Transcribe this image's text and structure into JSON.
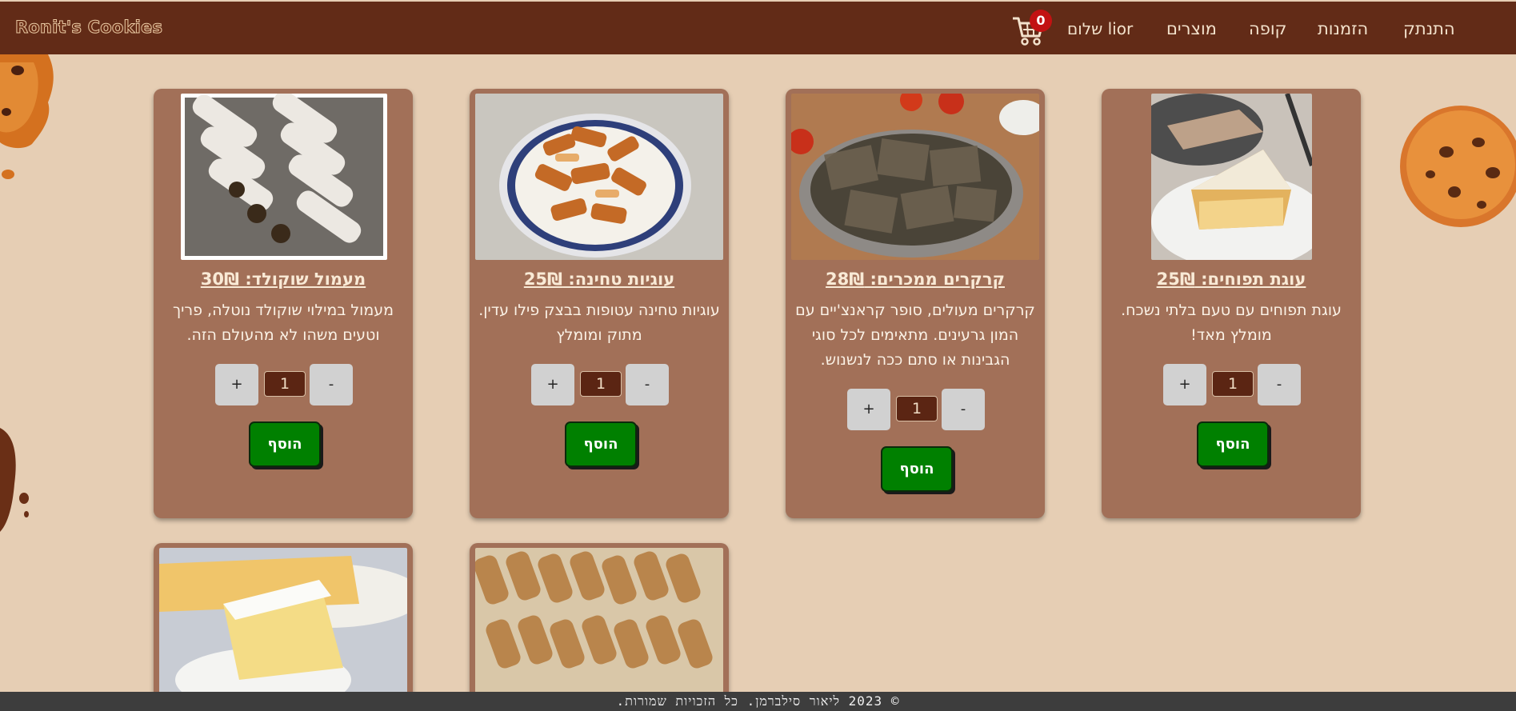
{
  "header": {
    "logo": "Ronit's Cookies",
    "nav": {
      "logout": "התנתק",
      "orders": "הזמנות",
      "checkout": "קופה",
      "products": "מוצרים"
    },
    "greeting": "שלום lior",
    "cart": {
      "count": "0",
      "icon": "cart-icon"
    }
  },
  "products": [
    {
      "title": "עוגת תפוחים: 25₪",
      "description": "עוגת תפוחים עם טעם בלתי נשכח. מומלץ מאד!",
      "quantity": "1",
      "plus": "+",
      "minus": "-",
      "add_label": "הוסף",
      "image": "apple-cake-photo"
    },
    {
      "title": "קרקרים ממכרים: 28₪",
      "description": "קרקרים מעולים, סופר קראנצ'יים עם המון גרעינים. מתאימים לכל סוגי הגבינות או סתם ככה לנשנוש.",
      "quantity": "1",
      "plus": "+",
      "minus": "-",
      "add_label": "הוסף",
      "image": "seed-crackers-photo"
    },
    {
      "title": "עוגיות טחינה: 25₪",
      "description": "עוגיות טחינה עטופות בבצק פילו עדין. מתוק ומומלץ",
      "quantity": "1",
      "plus": "+",
      "minus": "-",
      "add_label": "הוסף",
      "image": "tahini-filo-cookies-photo"
    },
    {
      "title": "מעמול שוקולד: 30₪",
      "description": "מעמול במילוי שוקולד נוטלה, פריך וטעים משהו לא מהעולם הזה.",
      "quantity": "1",
      "plus": "+",
      "minus": "-",
      "add_label": "הוסף",
      "image": "chocolate-maamoul-photo"
    },
    {
      "image": "biscotti-photo"
    },
    {
      "image": "sponge-cake-photo"
    }
  ],
  "footer": {
    "text": "© 2023 ליאור סילברמן. כל הזכויות שמורות."
  },
  "colors": {
    "navbar": "#622b17",
    "background": "#e6ceb4",
    "card": "#a27058",
    "add_button": "#008000",
    "badge": "#c21212",
    "footer": "#3d3d3d"
  }
}
